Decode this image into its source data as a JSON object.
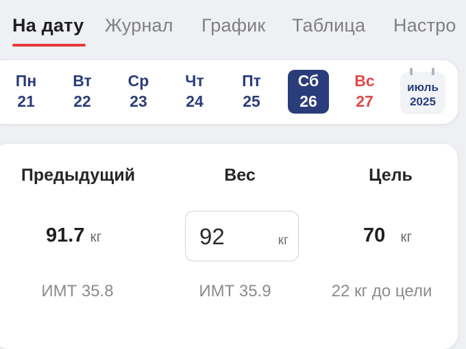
{
  "tabs": [
    {
      "label": "На дату",
      "active": true
    },
    {
      "label": "Журнал"
    },
    {
      "label": "График"
    },
    {
      "label": "Таблица"
    },
    {
      "label": "Настро"
    }
  ],
  "week": {
    "days": [
      {
        "name": "Пн",
        "num": "21"
      },
      {
        "name": "Вт",
        "num": "22"
      },
      {
        "name": "Ср",
        "num": "23"
      },
      {
        "name": "Чт",
        "num": "24"
      },
      {
        "name": "Пт",
        "num": "25"
      },
      {
        "name": "Сб",
        "num": "26",
        "selected": true
      },
      {
        "name": "Вс",
        "num": "27",
        "weekend": true
      }
    ],
    "month": {
      "name": "июль",
      "year": "2025"
    }
  },
  "weight": {
    "previous": {
      "title": "Предыдущий",
      "value": "91.7",
      "unit": "кг",
      "bmi": "ИМТ 35.8"
    },
    "current": {
      "title": "Вес",
      "value": "92",
      "unit": "кг",
      "bmi": "ИМТ 35.9"
    },
    "goal": {
      "title": "Цель",
      "value": "70",
      "unit": "кг",
      "remaining": "22 кг до цели"
    }
  },
  "colors": {
    "accent_red": "#e5373a",
    "selected_day_bg": "#2b3c7a",
    "day_text": "#2a3d7a",
    "weekend_text": "#e24848"
  }
}
